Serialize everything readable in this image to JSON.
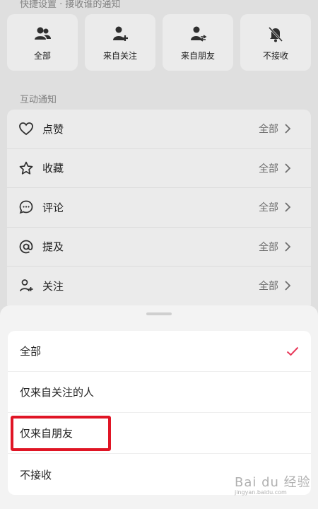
{
  "quick_settings": {
    "title": "快捷设置 · 接收谁的通知",
    "cards": [
      {
        "label": "全部",
        "icon": "group-icon"
      },
      {
        "label": "来自关注",
        "icon": "user-add-icon"
      },
      {
        "label": "来自朋友",
        "icon": "user-swap-icon"
      },
      {
        "label": "不接收",
        "icon": "bell-off-icon"
      }
    ]
  },
  "interaction": {
    "title": "互动通知",
    "rows": [
      {
        "name": "点赞",
        "value": "全部",
        "icon": "heart-icon"
      },
      {
        "name": "收藏",
        "value": "全部",
        "icon": "star-icon"
      },
      {
        "name": "评论",
        "value": "全部",
        "icon": "comment-icon"
      },
      {
        "name": "提及",
        "value": "全部",
        "icon": "at-icon"
      },
      {
        "name": "关注",
        "value": "全部",
        "icon": "user-add-icon"
      }
    ]
  },
  "sheet": {
    "options": [
      {
        "label": "全部",
        "selected": true
      },
      {
        "label": "仅来自关注的人",
        "selected": false
      },
      {
        "label": "仅来自朋友",
        "selected": false
      },
      {
        "label": "不接收",
        "selected": false
      }
    ],
    "check_color": "#e8395a",
    "highlight_color": "#e01525"
  },
  "watermark": {
    "text": "Bai du 经验",
    "sub": "jingyan.baidu.com"
  }
}
